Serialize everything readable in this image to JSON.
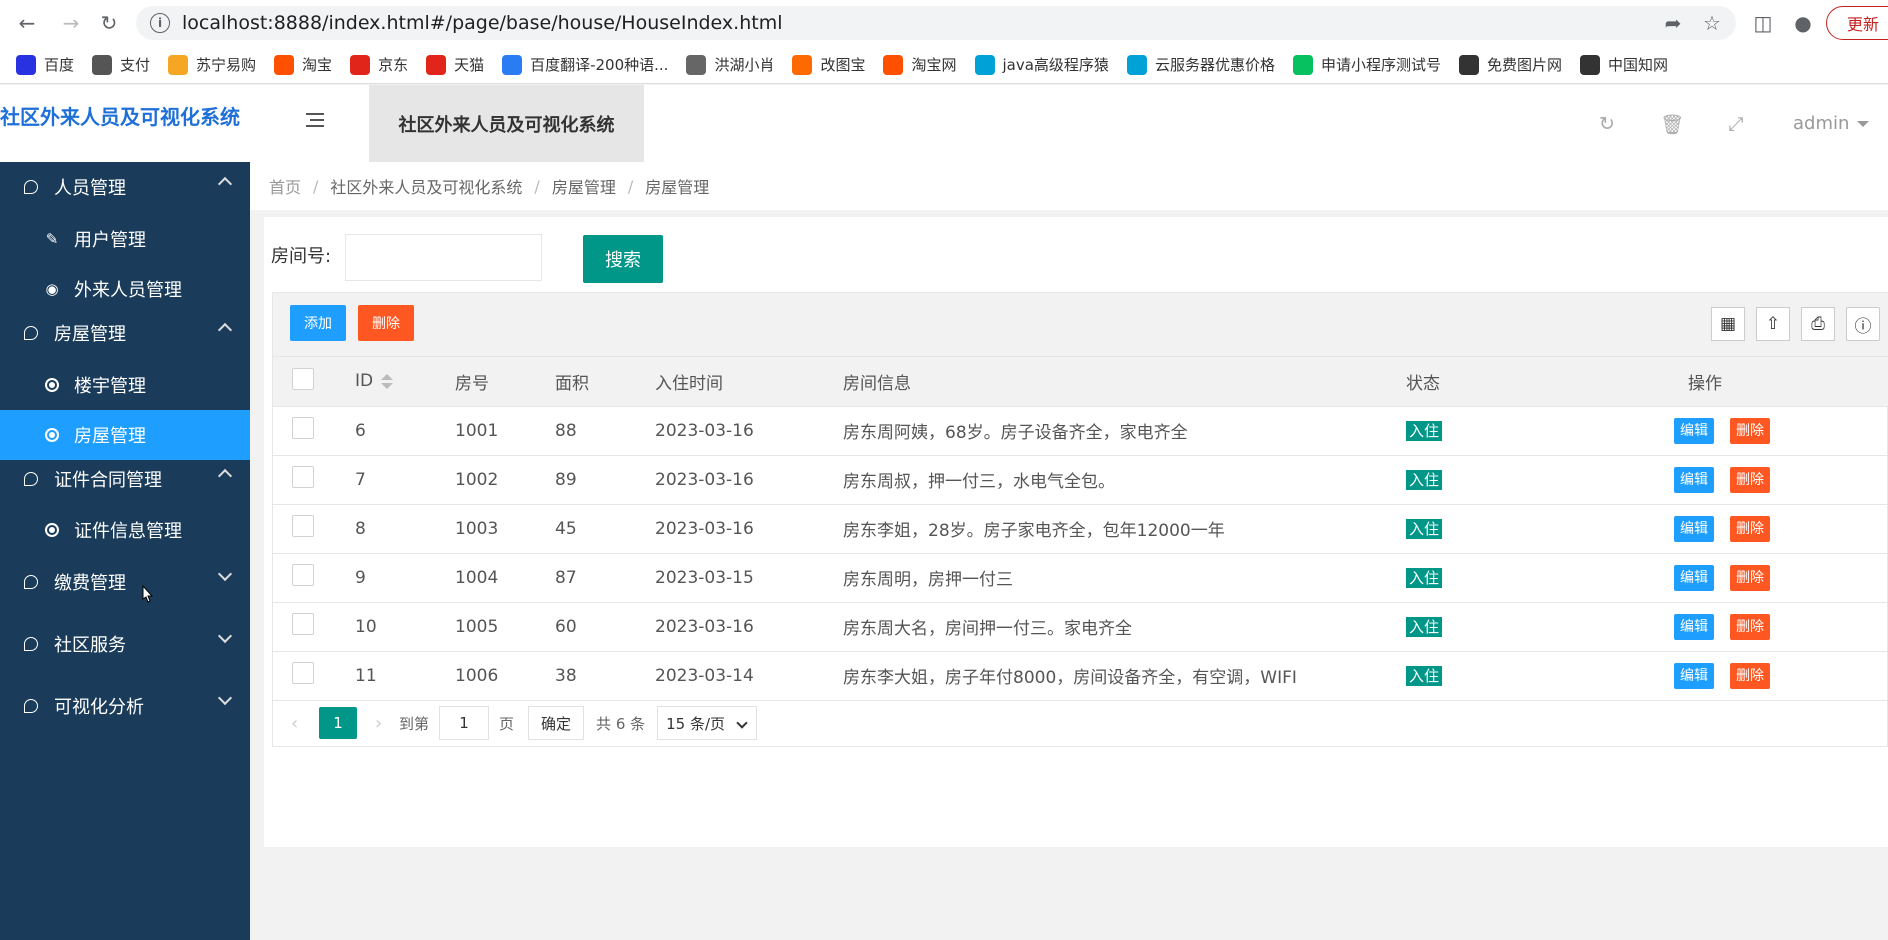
{
  "browser": {
    "url": "localhost:8888/index.html#/page/base/house/HouseIndex.html",
    "update_label": "更新",
    "bookmarks": [
      {
        "label": "百度",
        "color": "#2932e1"
      },
      {
        "label": "支付",
        "color": "#555555"
      },
      {
        "label": "苏宁易购",
        "color": "#f5a623"
      },
      {
        "label": "淘宝",
        "color": "#ff5000"
      },
      {
        "label": "京东",
        "color": "#e1251b"
      },
      {
        "label": "天猫",
        "color": "#e1251b"
      },
      {
        "label": "百度翻译-200种语...",
        "color": "#2b7bf3"
      },
      {
        "label": "洪湖小肖",
        "color": "#666666"
      },
      {
        "label": "改图宝",
        "color": "#ff6a00"
      },
      {
        "label": "淘宝网",
        "color": "#ff5000"
      },
      {
        "label": "java高级程序猿",
        "color": "#00a1d6"
      },
      {
        "label": "云服务器优惠价格",
        "color": "#00a1d6"
      },
      {
        "label": "申请小程序测试号",
        "color": "#07c160"
      },
      {
        "label": "免费图片网",
        "color": "#333333"
      },
      {
        "label": "中国知网",
        "color": "#333333"
      }
    ]
  },
  "app": {
    "logo": "社区外来人员及可视化系统",
    "header_tab": "社区外来人员及可视化系统",
    "user": "admin"
  },
  "sidebar": {
    "groups": [
      {
        "label": "人员管理",
        "expanded": true
      },
      {
        "label": "房屋管理",
        "expanded": true
      },
      {
        "label": "证件合同管理",
        "expanded": true
      },
      {
        "label": "缴费管理",
        "expanded": false
      },
      {
        "label": "社区服务",
        "expanded": false
      },
      {
        "label": "可视化分析",
        "expanded": false
      }
    ],
    "subs": [
      {
        "label": "用户管理",
        "icon": "edit-icon"
      },
      {
        "label": "外来人员管理",
        "icon": "dashboard-icon"
      },
      {
        "label": "楼宇管理",
        "icon": "circle-dot-icon"
      },
      {
        "label": "房屋管理",
        "icon": "circle-dot-icon",
        "active": true
      },
      {
        "label": "证件信息管理",
        "icon": "circle-dot-icon"
      }
    ]
  },
  "breadcrumb": [
    "首页",
    "社区外来人员及可视化系统",
    "房屋管理",
    "房屋管理"
  ],
  "search": {
    "label": "房间号:",
    "value": "",
    "button": "搜索"
  },
  "toolbar": {
    "add": "添加",
    "delete": "删除"
  },
  "table": {
    "headers": [
      "ID",
      "房号",
      "面积",
      "入住时间",
      "房间信息",
      "状态",
      "操作"
    ],
    "rows": [
      {
        "id": "6",
        "room": "1001",
        "area": "88",
        "date": "2023-03-16",
        "info": "房东周阿姨，68岁。房子设备齐全，家电齐全",
        "status": "入住"
      },
      {
        "id": "7",
        "room": "1002",
        "area": "89",
        "date": "2023-03-16",
        "info": "房东周叔，押一付三，水电气全包。",
        "status": "入住"
      },
      {
        "id": "8",
        "room": "1003",
        "area": "45",
        "date": "2023-03-16",
        "info": "房东李姐，28岁。房子家电齐全，包年12000一年",
        "status": "入住"
      },
      {
        "id": "9",
        "room": "1004",
        "area": "87",
        "date": "2023-03-15",
        "info": "房东周明，房押一付三",
        "status": "入住"
      },
      {
        "id": "10",
        "room": "1005",
        "area": "60",
        "date": "2023-03-16",
        "info": "房东周大名，房间押一付三。家电齐全",
        "status": "入住"
      },
      {
        "id": "11",
        "room": "1006",
        "area": "38",
        "date": "2023-03-14",
        "info": "房东李大姐，房子年付8000，房间设备齐全，有空调，WIFI",
        "status": "入住"
      }
    ],
    "edit_label": "编辑",
    "delete_label": "删除"
  },
  "pager": {
    "current": "1",
    "goto_label": "到第",
    "goto_value": "1",
    "page_label": "页",
    "confirm": "确定",
    "total": "共 6 条",
    "page_size": "15 条/页"
  },
  "colors": {
    "sidebar_bg": "#1a3c5a",
    "active": "#1e9fff",
    "primary": "#009688",
    "danger": "#ff5722",
    "normal": "#1e9fff"
  }
}
